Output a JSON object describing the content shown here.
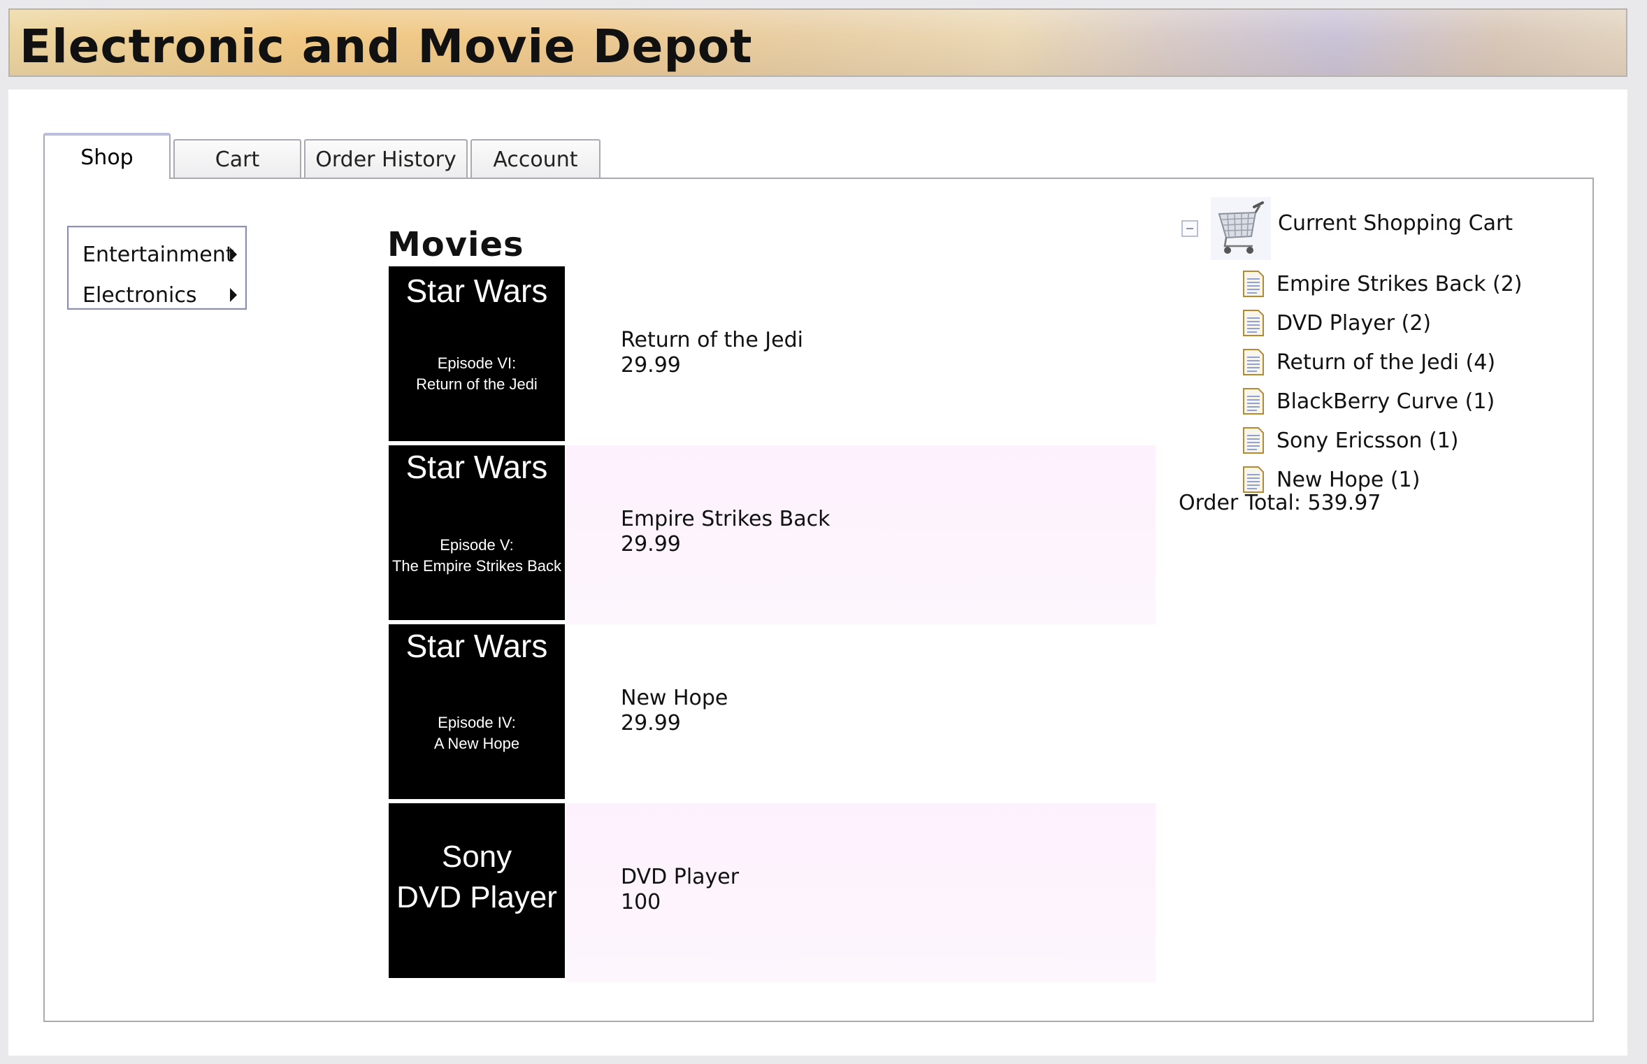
{
  "header": {
    "title": "Electronic and Movie Depot"
  },
  "tabs": [
    {
      "label": "Shop",
      "active": true
    },
    {
      "label": "Cart",
      "active": false
    },
    {
      "label": "Order History",
      "active": false
    },
    {
      "label": "Account",
      "active": false
    }
  ],
  "category_menu": {
    "items": [
      {
        "label": "Entertainment"
      },
      {
        "label": "Electronics"
      }
    ]
  },
  "section": {
    "title": "Movies"
  },
  "products": [
    {
      "poster_title": "Star Wars",
      "poster_sub_1": "Episode VI:",
      "poster_sub_2": "Return of the Jedi",
      "name": "Return of the Jedi",
      "price": "29.99"
    },
    {
      "poster_title": "Star Wars",
      "poster_sub_1": "Episode V:",
      "poster_sub_2": "The Empire Strikes Back",
      "name": "Empire Strikes Back",
      "price": "29.99"
    },
    {
      "poster_title": "Star Wars",
      "poster_sub_1": "Episode IV:",
      "poster_sub_2": "A New Hope",
      "name": "New Hope",
      "price": "29.99"
    },
    {
      "poster_line_1": "Sony",
      "poster_line_2": "DVD Player",
      "name": "DVD Player",
      "price": "100"
    }
  ],
  "cart": {
    "label": "Current Shopping Cart",
    "items": [
      {
        "label": "Empire Strikes Back (2)"
      },
      {
        "label": "DVD Player (2)"
      },
      {
        "label": "Return of the Jedi (4)"
      },
      {
        "label": "BlackBerry Curve (1)"
      },
      {
        "label": "Sony Ericsson (1)"
      },
      {
        "label": "New Hope (1)"
      }
    ],
    "order_total": "Order Total: 539.97"
  },
  "colors": {
    "alt_row_bg": "#fdf3fd",
    "poster_bg": "#000000",
    "panel_border": "#a9a9b0",
    "menu_border": "#8c8fb1"
  }
}
